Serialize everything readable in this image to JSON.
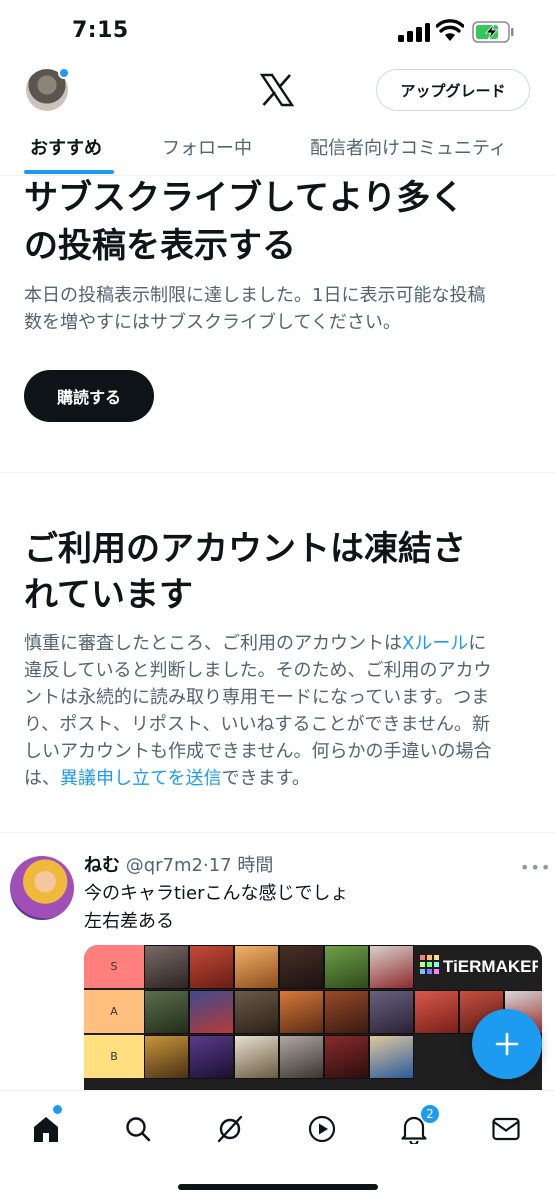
{
  "status_bar": {
    "time": "7:15"
  },
  "header": {
    "upgrade_label": "アップグレード"
  },
  "tabs": [
    {
      "label": "おすすめ",
      "active": true
    },
    {
      "label": "フォロー中",
      "active": false
    },
    {
      "label": "配信者向けコミュニティ",
      "active": false
    }
  ],
  "subscribe_notice": {
    "title_line1": "サブスクライブしてより多く",
    "title_line2": "の投稿を表示する",
    "body_line1": "本日の投稿表示制限に達しました。1日に表示可能な投稿",
    "body_line2": "数を増やすにはサブスクライブしてください。",
    "button_label": "購読する"
  },
  "frozen_notice": {
    "title_line1": "ご利用のアカウントは凍結さ",
    "title_line2": "れています",
    "body_line1_pre": "慎重に審査したところ、ご利用のアカウントは",
    "rules_link": "Xルール",
    "body_line1_post": "に",
    "body_line2": "違反していると判断しました。そのため、ご利用のアカウ",
    "body_line3": "ントは永続的に読み取り専用モードになっています。つま",
    "body_line4": "り、ポスト、リポスト、いいねすることができません。新",
    "body_line5": "しいアカウントも作成できません。何らかの手違いの場合",
    "body_line6_pre": "は、",
    "appeal_link": "異議申し立てを送信",
    "body_line6_post": "できます。"
  },
  "tweet": {
    "name": "ねむ",
    "handle": "@qr7m2",
    "separator": "·",
    "time": "17 時間",
    "text_line1": "今のキャラtierこんな感じでしょ",
    "text_line2": "左右差ある",
    "media": {
      "tiers": [
        {
          "label": "S",
          "color": "#ff7f7f"
        },
        {
          "label": "A",
          "color": "#ffbf7f"
        },
        {
          "label": "B",
          "color": "#ffdf7f"
        }
      ],
      "watermark": "TiERMAKER"
    }
  },
  "bottom_nav": {
    "notifications_badge": "2"
  },
  "colors": {
    "accent": "#1d9bf0",
    "text": "#0f1419",
    "muted": "#536471"
  },
  "icons": [
    "home-icon",
    "search-icon",
    "grok-icon",
    "video-icon",
    "bell-icon",
    "mail-icon",
    "plus-icon",
    "x-logo-icon"
  ]
}
